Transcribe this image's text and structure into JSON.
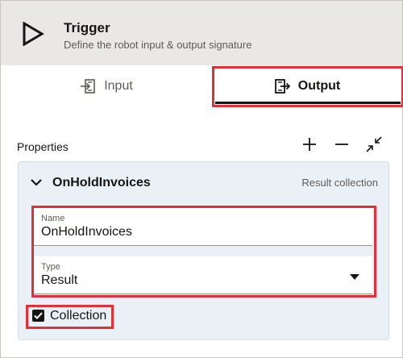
{
  "header": {
    "title": "Trigger",
    "subtitle": "Define the robot input & output signature",
    "icon": "play-icon"
  },
  "tabs": [
    {
      "label": "Input",
      "icon": "input-icon",
      "active": false
    },
    {
      "label": "Output",
      "icon": "output-icon",
      "active": true
    }
  ],
  "properties": {
    "label": "Properties",
    "toolbar": [
      {
        "name": "add",
        "icon": "plus-icon"
      },
      {
        "name": "remove",
        "icon": "minus-icon"
      },
      {
        "name": "collapse",
        "icon": "collapse-icon"
      }
    ]
  },
  "card": {
    "title": "OnHoldInvoices",
    "type_text": "Result collection",
    "name_field": {
      "label": "Name",
      "value": "OnHoldInvoices"
    },
    "type_field": {
      "label": "Type",
      "value": "Result"
    },
    "collection": {
      "label": "Collection",
      "checked": true
    }
  },
  "colors": {
    "header_bg": "#eae8e5",
    "card_bg": "#eaf1f6",
    "highlight": "#e0313b",
    "text": "#161513"
  }
}
